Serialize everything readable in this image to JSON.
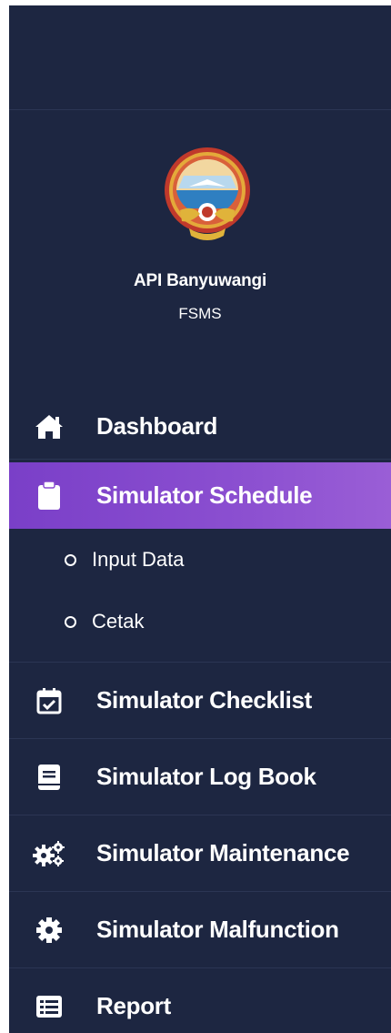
{
  "profile": {
    "name": "API Banyuwangi",
    "subtitle": "FSMS"
  },
  "nav": {
    "items": [
      {
        "label": "Dashboard",
        "icon": "home-icon"
      },
      {
        "label": "Simulator Schedule",
        "icon": "clipboard-icon",
        "active": true
      },
      {
        "label": "Simulator Checklist",
        "icon": "calendar-check-icon"
      },
      {
        "label": "Simulator Log Book",
        "icon": "book-icon"
      },
      {
        "label": "Simulator Maintenance",
        "icon": "cogs-icon"
      },
      {
        "label": "Simulator Malfunction",
        "icon": "gear-icon"
      },
      {
        "label": "Report",
        "icon": "list-icon"
      }
    ],
    "schedule_sub": [
      {
        "label": "Input Data"
      },
      {
        "label": "Cetak"
      }
    ]
  },
  "colors": {
    "sidebar_bg": "#1d2641",
    "active_gradient_start": "#7a3fc8",
    "active_gradient_end": "#9a5ed6",
    "text": "#ffffff"
  }
}
